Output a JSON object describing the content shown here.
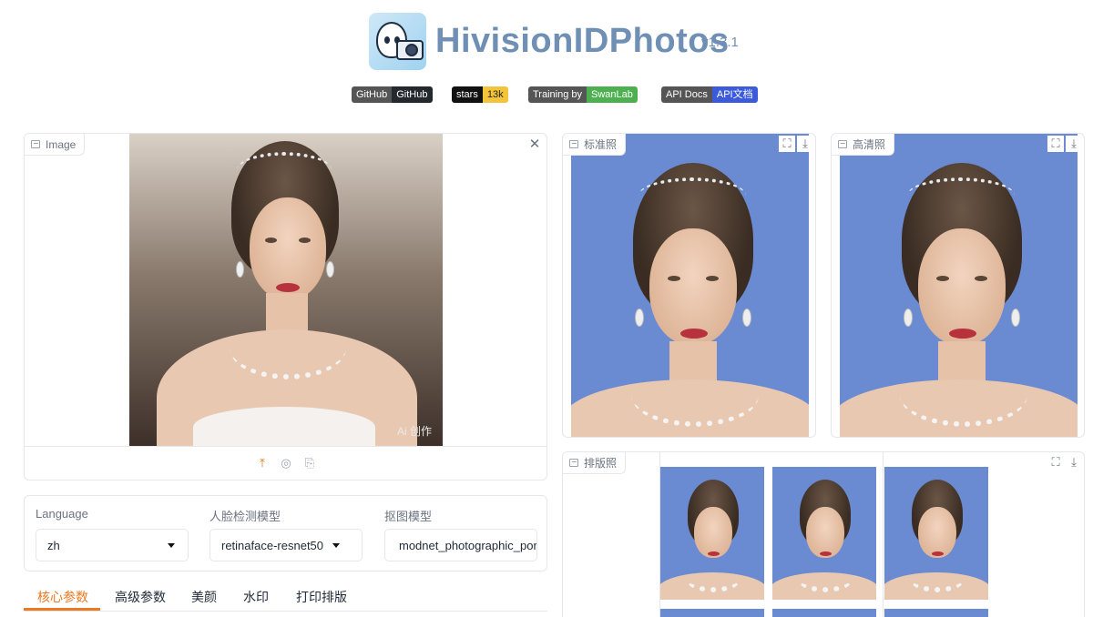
{
  "header": {
    "title": "HivisionIDPhotos",
    "version": "v1.3.1",
    "badges": [
      {
        "left": "GitHub",
        "right": "GitHub"
      },
      {
        "left": "stars",
        "right": "13k"
      },
      {
        "left": "Training by",
        "right": "SwanLab"
      },
      {
        "left": "API Docs",
        "right": "API文档"
      }
    ]
  },
  "input_panel": {
    "label": "Image",
    "watermark": "Ai 创作",
    "close_icon": "✕",
    "upload_icon": "⤒",
    "webcam_icon": "◎",
    "clipboard_icon": "⎘"
  },
  "outputs": {
    "standard_label": "标准照",
    "hd_label": "高清照",
    "layout_label": "排版照",
    "fullscreen_icon": "⛶",
    "download_icon": "⤓"
  },
  "settings": {
    "language_label": "Language",
    "language_value": "zh",
    "face_model_label": "人脸检测模型",
    "face_model_value": "retinaface-resnet50",
    "matting_model_label": "抠图模型",
    "matting_model_value": "modnet_photographic_portrait_matting"
  },
  "tabs": [
    {
      "label": "核心参数",
      "active": true
    },
    {
      "label": "高级参数",
      "active": false
    },
    {
      "label": "美颜",
      "active": false
    },
    {
      "label": "水印",
      "active": false
    },
    {
      "label": "打印排版",
      "active": false
    }
  ],
  "colors": {
    "accent": "#ea7a1f",
    "title": "#6f8fb5",
    "id_background": "#6a8ad1"
  }
}
